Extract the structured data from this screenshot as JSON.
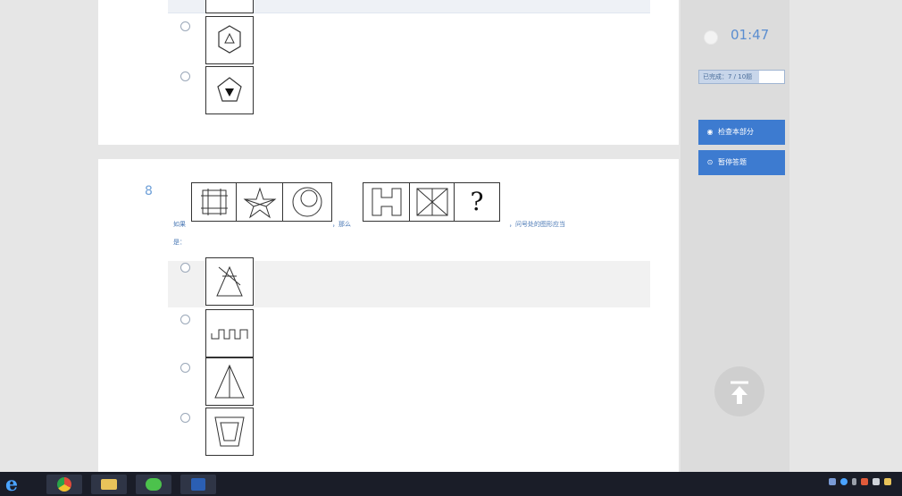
{
  "question": {
    "number": "8",
    "prompt_prefix": "如果",
    "prompt_middle": "，那么",
    "prompt_suffix": "，问号处的图形应当",
    "prompt_line2": "是：",
    "question_mark": "?"
  },
  "sidebar": {
    "timer": "01:47",
    "answered_label": "已完成：7 / 10题",
    "review_button": "检查本部分",
    "pause_button": "暂停答题"
  },
  "icons": {
    "clock": "clock-icon",
    "eye": "eye-icon",
    "pause": "pause-icon",
    "back_to_top": "arrow-up-icon"
  },
  "colors": {
    "accent": "#3d7bd0",
    "question_text": "#4a78b5",
    "taskbar": "#1a1d28"
  }
}
